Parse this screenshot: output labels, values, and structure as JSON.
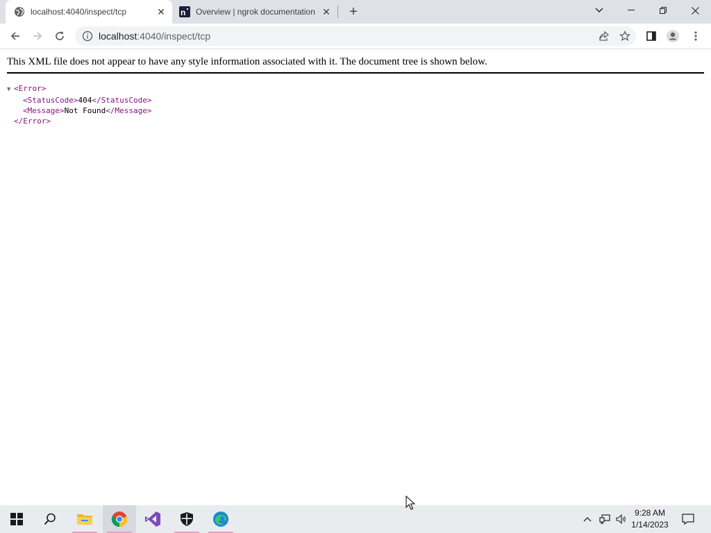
{
  "browser": {
    "tabs": [
      {
        "title": "localhost:4040/inspect/tcp",
        "favicon": "globe-icon",
        "active": true
      },
      {
        "title": "Overview | ngrok documentation",
        "favicon": "ngrok-icon",
        "active": false
      }
    ],
    "address": {
      "host": "localhost",
      "path": ":4040/inspect/tcp"
    }
  },
  "page": {
    "notice": "This XML file does not appear to have any style information associated with it. The document tree is shown below.",
    "xml": {
      "root_open": "<Error>",
      "status_open": "<StatusCode>",
      "status_value": "404",
      "status_close": "</StatusCode>",
      "message_open": "<Message>",
      "message_value": "Not Found",
      "message_close": "</Message>",
      "root_close": "</Error>",
      "toggle_glyph": "▼"
    }
  },
  "taskbar": {
    "apps": [
      "windows-start-icon",
      "search-icon",
      "file-explorer-icon",
      "chrome-icon",
      "visual-studio-icon",
      "windows-security-icon",
      "edge-icon"
    ],
    "clock": {
      "time": "9:28 AM",
      "date": "1/14/2023"
    }
  },
  "colors": {
    "tabstrip_bg": "#dee1e6",
    "xml_tag": "#881280",
    "taskbar_bg": "#e9ecef"
  }
}
